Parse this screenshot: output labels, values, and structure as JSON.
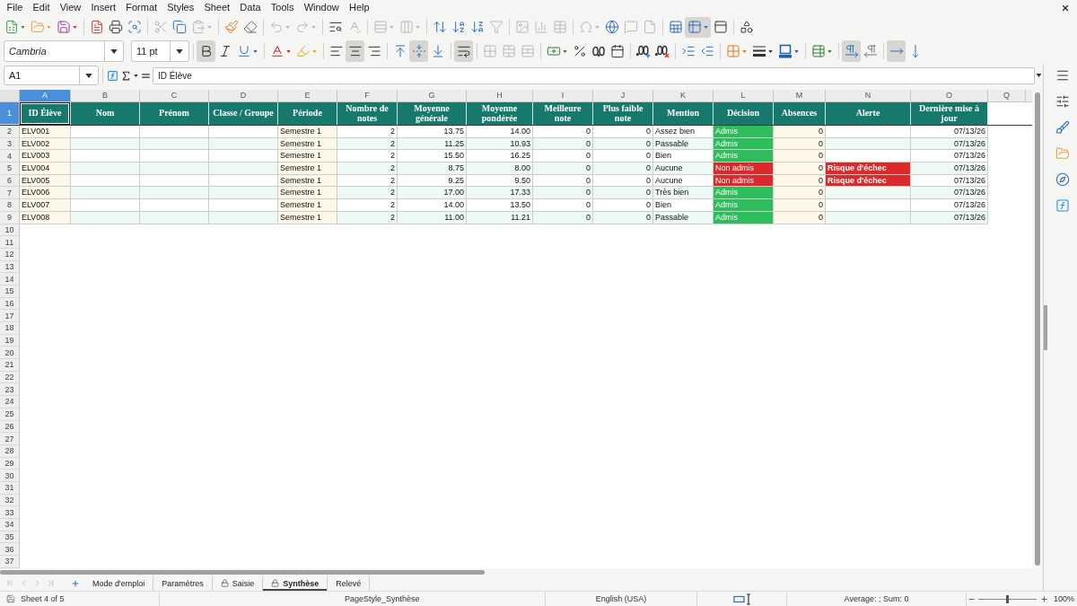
{
  "menu": [
    "File",
    "Edit",
    "View",
    "Insert",
    "Format",
    "Styles",
    "Sheet",
    "Data",
    "Tools",
    "Window",
    "Help"
  ],
  "standard_toolbar": {
    "groups": [
      [
        {
          "active": false,
          "disabled": false,
          "dropdown": true
        },
        {
          "active": false,
          "disabled": false,
          "dropdown": true
        },
        {
          "active": false,
          "disabled": false,
          "dropdown": true
        }
      ],
      [
        {
          "active": false,
          "disabled": false,
          "dropdown": false
        },
        {
          "active": false,
          "disabled": false,
          "dropdown": false
        },
        {
          "active": false,
          "disabled": false,
          "dropdown": false
        }
      ],
      [
        {
          "active": false,
          "disabled": true,
          "dropdown": false
        },
        {
          "active": false,
          "disabled": false,
          "dropdown": false
        },
        {
          "active": false,
          "disabled": true,
          "dropdown": true
        }
      ],
      [
        {
          "active": false,
          "disabled": false,
          "dropdown": false
        },
        {
          "active": false,
          "disabled": false,
          "dropdown": false
        }
      ],
      [
        {
          "active": false,
          "disabled": true,
          "dropdown": true
        },
        {
          "active": false,
          "disabled": true,
          "dropdown": true
        }
      ],
      [
        {
          "active": false,
          "disabled": false,
          "dropdown": false
        },
        {
          "active": false,
          "disabled": true,
          "dropdown": false
        }
      ],
      [
        {
          "active": false,
          "disabled": true,
          "dropdown": true
        },
        {
          "active": false,
          "disabled": true,
          "dropdown": true
        }
      ],
      [
        {
          "active": false,
          "disabled": false,
          "dropdown": false
        },
        {
          "active": false,
          "disabled": false,
          "dropdown": false
        },
        {
          "active": false,
          "disabled": false,
          "dropdown": false
        },
        {
          "active": false,
          "disabled": true,
          "dropdown": false
        }
      ],
      [
        {
          "active": false,
          "disabled": true,
          "dropdown": false
        },
        {
          "active": false,
          "disabled": true,
          "dropdown": false
        },
        {
          "active": false,
          "disabled": true,
          "dropdown": false
        }
      ],
      [
        {
          "active": false,
          "disabled": true,
          "dropdown": true
        },
        {
          "active": false,
          "disabled": false,
          "dropdown": false
        },
        {
          "active": false,
          "disabled": true,
          "dropdown": false
        },
        {
          "active": false,
          "disabled": true,
          "dropdown": false
        }
      ],
      [
        {
          "active": false,
          "disabled": false,
          "dropdown": false
        },
        {
          "active": true,
          "disabled": false,
          "dropdown": true
        },
        {
          "active": false,
          "disabled": false,
          "dropdown": false
        }
      ],
      [
        {
          "active": false,
          "disabled": false,
          "dropdown": false
        }
      ]
    ]
  },
  "formatting_toolbar": {
    "font_name": "Cambria",
    "font_size": "11 pt",
    "groups": [
      [
        {
          "active": true,
          "disabled": false,
          "dropdown": false
        },
        {
          "active": false,
          "disabled": false,
          "dropdown": false
        },
        {
          "active": false,
          "disabled": false,
          "dropdown": true
        }
      ],
      [
        {
          "active": false,
          "disabled": false,
          "dropdown": true
        },
        {
          "active": false,
          "disabled": false,
          "dropdown": true
        }
      ],
      [
        {
          "active": false,
          "disabled": false,
          "dropdown": false
        },
        {
          "active": true,
          "disabled": false,
          "dropdown": false
        },
        {
          "active": false,
          "disabled": false,
          "dropdown": false
        }
      ],
      [
        {
          "active": false,
          "disabled": false,
          "dropdown": false
        },
        {
          "active": true,
          "disabled": false,
          "dropdown": false
        },
        {
          "active": false,
          "disabled": false,
          "dropdown": false
        }
      ],
      [
        {
          "active": true,
          "disabled": false,
          "dropdown": false
        }
      ],
      [
        {
          "active": false,
          "disabled": true,
          "dropdown": false
        },
        {
          "active": false,
          "disabled": true,
          "dropdown": false
        },
        {
          "active": false,
          "disabled": true,
          "dropdown": false
        }
      ],
      [
        {
          "active": false,
          "disabled": false,
          "dropdown": true
        },
        {
          "active": false,
          "disabled": false,
          "dropdown": false
        },
        {
          "active": false,
          "disabled": false,
          "dropdown": false
        },
        {
          "active": false,
          "disabled": false,
          "dropdown": false
        }
      ],
      [
        {
          "active": false,
          "disabled": false,
          "dropdown": false
        },
        {
          "active": false,
          "disabled": false,
          "dropdown": false
        }
      ],
      [
        {
          "active": false,
          "disabled": false,
          "dropdown": false
        },
        {
          "active": false,
          "disabled": false,
          "dropdown": false
        }
      ],
      [
        {
          "active": false,
          "disabled": false,
          "dropdown": true
        },
        {
          "active": false,
          "disabled": false,
          "dropdown": true
        },
        {
          "active": false,
          "disabled": false,
          "dropdown": true
        }
      ],
      [
        {
          "active": false,
          "disabled": false,
          "dropdown": true
        }
      ],
      [
        {
          "active": true,
          "disabled": false,
          "dropdown": false
        },
        {
          "active": false,
          "disabled": false,
          "dropdown": false
        }
      ],
      [
        {
          "active": true,
          "disabled": false,
          "dropdown": false
        },
        {
          "active": false,
          "disabled": false,
          "dropdown": false
        }
      ]
    ]
  },
  "formula_bar": {
    "cell_reference": "A1",
    "content": "ID Élève"
  },
  "column_headers": [
    {
      "label": "A",
      "selected": true
    },
    {
      "label": "B",
      "selected": false
    },
    {
      "label": "C",
      "selected": false
    },
    {
      "label": "D",
      "selected": false
    },
    {
      "label": "E",
      "selected": false
    },
    {
      "label": "F",
      "selected": false
    },
    {
      "label": "G",
      "selected": false
    },
    {
      "label": "H",
      "selected": false
    },
    {
      "label": "I",
      "selected": false
    },
    {
      "label": "J",
      "selected": false
    },
    {
      "label": "K",
      "selected": false
    },
    {
      "label": "L",
      "selected": false
    },
    {
      "label": "M",
      "selected": false
    },
    {
      "label": "N",
      "selected": false
    },
    {
      "label": "O",
      "selected": false
    },
    {
      "label": "Q",
      "selected": false
    }
  ],
  "row_headers": [
    {
      "label": "1",
      "selected": true
    },
    {
      "label": "2",
      "selected": false
    },
    {
      "label": "3",
      "selected": false
    },
    {
      "label": "4",
      "selected": false
    },
    {
      "label": "5",
      "selected": false
    },
    {
      "label": "6",
      "selected": false
    },
    {
      "label": "7",
      "selected": false
    },
    {
      "label": "8",
      "selected": false
    },
    {
      "label": "9",
      "selected": false
    },
    {
      "label": "10",
      "selected": false
    },
    {
      "label": "11",
      "selected": false
    },
    {
      "label": "12",
      "selected": false
    },
    {
      "label": "13",
      "selected": false
    },
    {
      "label": "14",
      "selected": false
    },
    {
      "label": "15",
      "selected": false
    },
    {
      "label": "16",
      "selected": false
    },
    {
      "label": "17",
      "selected": false
    },
    {
      "label": "18",
      "selected": false
    },
    {
      "label": "19",
      "selected": false
    },
    {
      "label": "20",
      "selected": false
    },
    {
      "label": "21",
      "selected": false
    },
    {
      "label": "22",
      "selected": false
    },
    {
      "label": "23",
      "selected": false
    },
    {
      "label": "24",
      "selected": false
    },
    {
      "label": "25",
      "selected": false
    },
    {
      "label": "26",
      "selected": false
    },
    {
      "label": "27",
      "selected": false
    },
    {
      "label": "28",
      "selected": false
    },
    {
      "label": "29",
      "selected": false
    },
    {
      "label": "30",
      "selected": false
    },
    {
      "label": "31",
      "selected": false
    },
    {
      "label": "32",
      "selected": false
    },
    {
      "label": "33",
      "selected": false
    },
    {
      "label": "34",
      "selected": false
    },
    {
      "label": "35",
      "selected": false
    },
    {
      "label": "36",
      "selected": false
    },
    {
      "label": "37",
      "selected": false
    }
  ],
  "header_row": [
    {
      "text": "ID Élève",
      "selected": true
    },
    {
      "text": "Nom",
      "selected": false
    },
    {
      "text": "Prénom",
      "selected": false
    },
    {
      "text": "Classe / Groupe",
      "selected": false
    },
    {
      "text": "Période",
      "selected": false
    },
    {
      "text": "Nombre de notes",
      "selected": false
    },
    {
      "text": "Moyenne générale",
      "selected": false
    },
    {
      "text": "Moyenne pondérée",
      "selected": false
    },
    {
      "text": "Meilleure note",
      "selected": false
    },
    {
      "text": "Plus faible note",
      "selected": false
    },
    {
      "text": "Mention",
      "selected": false
    },
    {
      "text": "Décision",
      "selected": false
    },
    {
      "text": "Absences",
      "selected": false
    },
    {
      "text": "Alerte",
      "selected": false
    },
    {
      "text": "Dernière mise à jour",
      "selected": false
    }
  ],
  "rows": [
    {
      "id_eleve": "ELV001",
      "periode": "Semestre 1",
      "nombre_de_notes": "2",
      "moyenne_generale": "13.75",
      "moyenne_ponderee": "14.00",
      "meilleure_note": "0",
      "plus_faible_note": "0",
      "mention": "Assez bien",
      "decision": {
        "text": "Admis",
        "color": "#2dbd5a"
      },
      "absences": "0",
      "derniere_mise_a_jour": "07/13/26"
    },
    {
      "id_eleve": "ELV002",
      "periode": "Semestre 1",
      "nombre_de_notes": "2",
      "moyenne_generale": "11.25",
      "moyenne_ponderee": "10.93",
      "meilleure_note": "0",
      "plus_faible_note": "0",
      "mention": "Passable",
      "decision": {
        "text": "Admis",
        "color": "#2dbd5a"
      },
      "absences": "0",
      "derniere_mise_a_jour": "07/13/26"
    },
    {
      "id_eleve": "ELV003",
      "periode": "Semestre 1",
      "nombre_de_notes": "2",
      "moyenne_generale": "15.50",
      "moyenne_ponderee": "16.25",
      "meilleure_note": "0",
      "plus_faible_note": "0",
      "mention": "Bien",
      "decision": {
        "text": "Admis",
        "color": "#2dbd5a"
      },
      "absences": "0",
      "derniere_mise_a_jour": "07/13/26"
    },
    {
      "id_eleve": "ELV004",
      "periode": "Semestre 1",
      "nombre_de_notes": "2",
      "moyenne_generale": "8.75",
      "moyenne_ponderee": "8.00",
      "meilleure_note": "0",
      "plus_faible_note": "0",
      "mention": "Aucune",
      "decision": {
        "text": "Non admis",
        "color": "#dc2a2a"
      },
      "absences": "0",
      "alerte": {
        "text": "Risque d'échec",
        "color": "#dc2a2a"
      },
      "derniere_mise_a_jour": "07/13/26"
    },
    {
      "id_eleve": "ELV005",
      "periode": "Semestre 1",
      "nombre_de_notes": "2",
      "moyenne_generale": "9.25",
      "moyenne_ponderee": "9.50",
      "meilleure_note": "0",
      "plus_faible_note": "0",
      "mention": "Aucune",
      "decision": {
        "text": "Non admis",
        "color": "#dc2a2a"
      },
      "absences": "0",
      "alerte": {
        "text": "Risque d'échec",
        "color": "#dc2a2a"
      },
      "derniere_mise_a_jour": "07/13/26"
    },
    {
      "id_eleve": "ELV006",
      "periode": "Semestre 1",
      "nombre_de_notes": "2",
      "moyenne_generale": "17.00",
      "moyenne_ponderee": "17.33",
      "meilleure_note": "0",
      "plus_faible_note": "0",
      "mention": "Très bien",
      "decision": {
        "text": "Admis",
        "color": "#2dbd5a"
      },
      "absences": "0",
      "derniere_mise_a_jour": "07/13/26"
    },
    {
      "id_eleve": "ELV007",
      "periode": "Semestre 1",
      "nombre_de_notes": "2",
      "moyenne_generale": "14.00",
      "moyenne_ponderee": "13.50",
      "meilleure_note": "0",
      "plus_faible_note": "0",
      "mention": "Bien",
      "decision": {
        "text": "Admis",
        "color": "#2dbd5a"
      },
      "absences": "0",
      "derniere_mise_a_jour": "07/13/26"
    },
    {
      "id_eleve": "ELV008",
      "periode": "Semestre 1",
      "nombre_de_notes": "2",
      "moyenne_generale": "11.00",
      "moyenne_ponderee": "11.21",
      "meilleure_note": "0",
      "plus_faible_note": "0",
      "mention": "Passable",
      "decision": {
        "text": "Admis",
        "color": "#2dbd5a"
      },
      "absences": "0",
      "derniere_mise_a_jour": "07/13/26"
    }
  ],
  "sheet_navigation": [
    {
      "disabled": true
    },
    {
      "disabled": true
    },
    {
      "disabled": true
    },
    {
      "disabled": true
    }
  ],
  "sheet_tabs": [
    {
      "label": "Mode d'emploi",
      "selected": false,
      "protected": false
    },
    {
      "label": "Paramètres",
      "selected": false,
      "protected": false
    },
    {
      "label": "Saisie",
      "selected": false,
      "protected": true
    },
    {
      "label": "Synthèse",
      "selected": true,
      "protected": true
    },
    {
      "label": "Relevé",
      "selected": false,
      "protected": false
    }
  ],
  "status_bar": {
    "sheet_position": "Sheet 4 of 5",
    "page_style": "PageStyle_Synthèse",
    "language": "English (USA)",
    "selection_summary": "Average: ; Sum: 0",
    "zoom_slider": {
      "level": 0.5
    },
    "zoom": "100%"
  }
}
